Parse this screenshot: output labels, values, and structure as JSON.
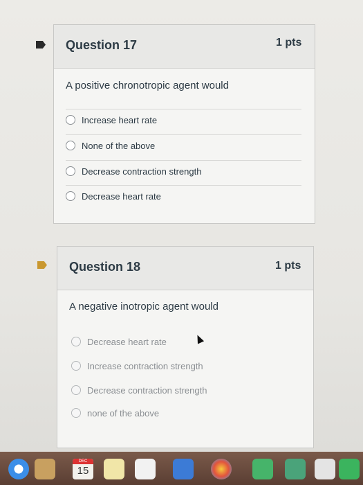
{
  "questions": [
    {
      "title": "Question 17",
      "points": "1 pts",
      "prompt": "A positive chronotropic agent would",
      "answers": [
        "Increase heart rate",
        "None of the above",
        "Decrease contraction strength",
        "Decrease heart rate"
      ]
    },
    {
      "title": "Question 18",
      "points": "1 pts",
      "prompt": "A negative inotropic agent would",
      "answers": [
        "Decrease heart rate",
        "Increase contraction strength",
        "Decrease contraction strength",
        "none of the above"
      ]
    }
  ],
  "dock": {
    "calendar_month": "DEC",
    "calendar_day": "15"
  },
  "colors": {
    "flag_q17": "#2a2a2a",
    "flag_q18": "#c9972f",
    "text": "#2d3b45"
  }
}
